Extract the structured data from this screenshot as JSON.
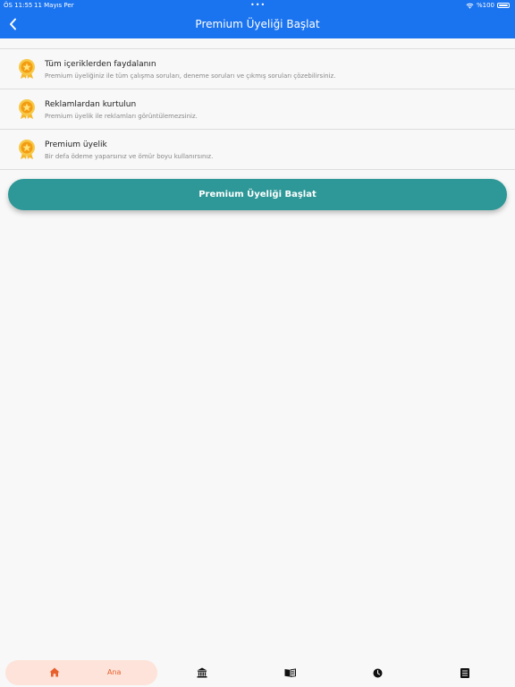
{
  "status_bar": {
    "time": "ÖS 11:55",
    "date": "11 Mayıs Per",
    "dots": "•••",
    "battery": "%100"
  },
  "nav": {
    "title": "Premium Üyeliği Başlat"
  },
  "features": [
    {
      "title": "Tüm içeriklerden faydalanın",
      "description": "Premium üyeliğiniz ile tüm çalışma soruları, deneme soruları ve çıkmış soruları çözebilirsiniz."
    },
    {
      "title": "Reklamlardan kurtulun",
      "description": "Premium üyelik ile reklamları görüntülemezsiniz."
    },
    {
      "title": "Premium üyelik",
      "description": "Bir defa ödeme yaparsınız ve ömür boyu kullanırsınız."
    }
  ],
  "cta": {
    "label": "Premium Üyeliği Başlat"
  },
  "tab_bar": {
    "home_label": "Ana",
    "active_color": "#e8602d",
    "icons": [
      "home-icon",
      "bank-icon",
      "book-icon",
      "clock-icon",
      "list-icon"
    ]
  },
  "colors": {
    "header": "#1a73ef",
    "button": "#2e9797",
    "active_tab_bg": "#fde3d9"
  }
}
